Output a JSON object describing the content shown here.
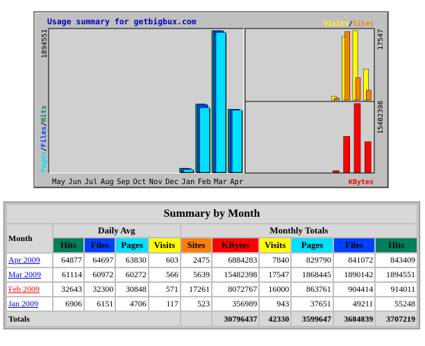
{
  "graph": {
    "title": "Usage summary for getbigbux.com",
    "left_axis_max": "1894551",
    "right_top_axis_max": "17547",
    "right_bottom_axis_max": "15482398",
    "legend_left": [
      "Pages",
      "/",
      "Files",
      "/",
      "Hits"
    ],
    "legend_top_right": [
      "Visits",
      "/",
      "Sites"
    ],
    "legend_bottom_right": "KBytes",
    "months": [
      "May",
      "Jun",
      "Jul",
      "Aug",
      "Sep",
      "Oct",
      "Nov",
      "Dec",
      "Jan",
      "Feb",
      "Mar",
      "Apr"
    ]
  },
  "chart_data": [
    {
      "type": "bar",
      "categories": [
        "May",
        "Jun",
        "Jul",
        "Aug",
        "Sep",
        "Oct",
        "Nov",
        "Dec",
        "Jan",
        "Feb",
        "Mar",
        "Apr"
      ],
      "series": [
        {
          "name": "Hits",
          "values": [
            0,
            0,
            0,
            0,
            0,
            0,
            0,
            0,
            55248,
            914011,
            1894551,
            843409
          ]
        },
        {
          "name": "Files",
          "values": [
            0,
            0,
            0,
            0,
            0,
            0,
            0,
            0,
            49211,
            904414,
            1890142,
            841072
          ]
        },
        {
          "name": "Pages",
          "values": [
            0,
            0,
            0,
            0,
            0,
            0,
            0,
            0,
            37651,
            863761,
            1868445,
            829790
          ]
        }
      ],
      "ylim": [
        0,
        1894551
      ]
    },
    {
      "type": "bar",
      "categories": [
        "May",
        "Jun",
        "Jul",
        "Aug",
        "Sep",
        "Oct",
        "Nov",
        "Dec",
        "Jan",
        "Feb",
        "Mar",
        "Apr"
      ],
      "series": [
        {
          "name": "Visits",
          "values": [
            0,
            0,
            0,
            0,
            0,
            0,
            0,
            0,
            943,
            16000,
            17547,
            7840
          ]
        },
        {
          "name": "Sites",
          "values": [
            0,
            0,
            0,
            0,
            0,
            0,
            0,
            0,
            523,
            17261,
            5639,
            2475
          ]
        }
      ],
      "ylim": [
        0,
        17547
      ]
    },
    {
      "type": "bar",
      "categories": [
        "May",
        "Jun",
        "Jul",
        "Aug",
        "Sep",
        "Oct",
        "Nov",
        "Dec",
        "Jan",
        "Feb",
        "Mar",
        "Apr"
      ],
      "series": [
        {
          "name": "KBytes",
          "values": [
            0,
            0,
            0,
            0,
            0,
            0,
            0,
            0,
            356989,
            8072767,
            15482398,
            6884283
          ]
        }
      ],
      "ylim": [
        0,
        15482398
      ]
    }
  ],
  "table": {
    "title": "Summary by Month",
    "month_header": "Month",
    "daily_avg_header": "Daily Avg",
    "monthly_totals_header": "Monthly Totals",
    "daily_cols": [
      "Hits",
      "Files",
      "Pages",
      "Visits"
    ],
    "monthly_cols": [
      "Sites",
      "KBytes",
      "Visits",
      "Pages",
      "Files",
      "Hits"
    ],
    "rows": [
      {
        "month": "Apr 2009",
        "current": false,
        "cells": [
          "64877",
          "64697",
          "63830",
          "603",
          "2475",
          "6884283",
          "7840",
          "829790",
          "841072",
          "843409"
        ]
      },
      {
        "month": "Mar 2009",
        "current": false,
        "cells": [
          "61114",
          "60972",
          "60272",
          "566",
          "5639",
          "15482398",
          "17547",
          "1868445",
          "1890142",
          "1894551"
        ]
      },
      {
        "month": "Feb 2009",
        "current": true,
        "cells": [
          "32643",
          "32300",
          "30848",
          "571",
          "17261",
          "8072767",
          "16000",
          "863761",
          "904414",
          "914011"
        ]
      },
      {
        "month": "Jan 2009",
        "current": false,
        "cells": [
          "6906",
          "6151",
          "4706",
          "117",
          "523",
          "356989",
          "943",
          "37651",
          "49211",
          "55248"
        ]
      }
    ],
    "totals_label": "Totals",
    "totals": [
      "30796437",
      "42330",
      "3599647",
      "3684839",
      "3707219"
    ]
  },
  "colors": {
    "hits": "#00805c",
    "files": "#0040ff",
    "pages": "#00e0ff",
    "visits": "#ffff00",
    "sites": "#ff8000",
    "kbytes": "#ff0000",
    "title": "#0000c0",
    "panel": "#c0c0c0"
  }
}
